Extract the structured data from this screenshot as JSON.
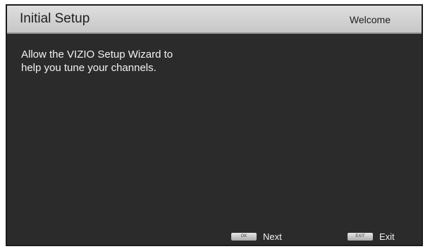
{
  "header": {
    "title": "Initial Setup",
    "subtitle": "Welcome"
  },
  "body": {
    "message_line1": "Allow the VIZIO Setup Wizard to",
    "message_line2": "help you tune your channels."
  },
  "footer": {
    "next_key": "OK",
    "next_label": "Next",
    "exit_key": "EXIT",
    "exit_label": "Exit"
  }
}
